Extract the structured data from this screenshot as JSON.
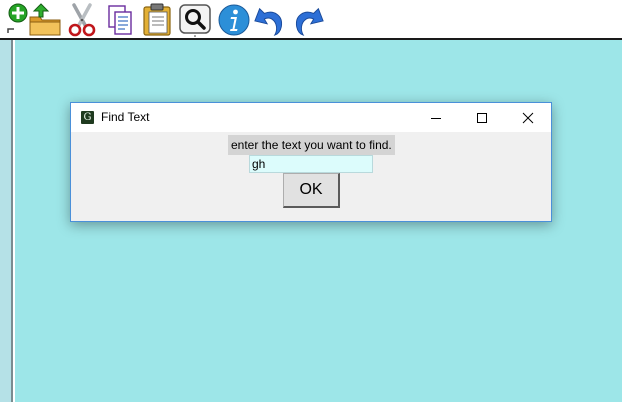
{
  "toolbar": {
    "icons": [
      "new-icon",
      "open-folder-icon",
      "cut-icon",
      "copy-icon",
      "paste-icon",
      "find-icon",
      "info-icon",
      "undo-icon",
      "redo-icon"
    ]
  },
  "dialog": {
    "title": "Find Text",
    "app_icon_letter": "G",
    "prompt": "enter the text you want to find.",
    "input_value": "gh",
    "ok_label": "OK"
  },
  "colors": {
    "workspace": "#9de6e8",
    "gutter": "#b5e1e7",
    "input_background": "#dcfcfc",
    "dialog_border": "#4a90d9",
    "icon_blue": "#2d6fd6"
  }
}
